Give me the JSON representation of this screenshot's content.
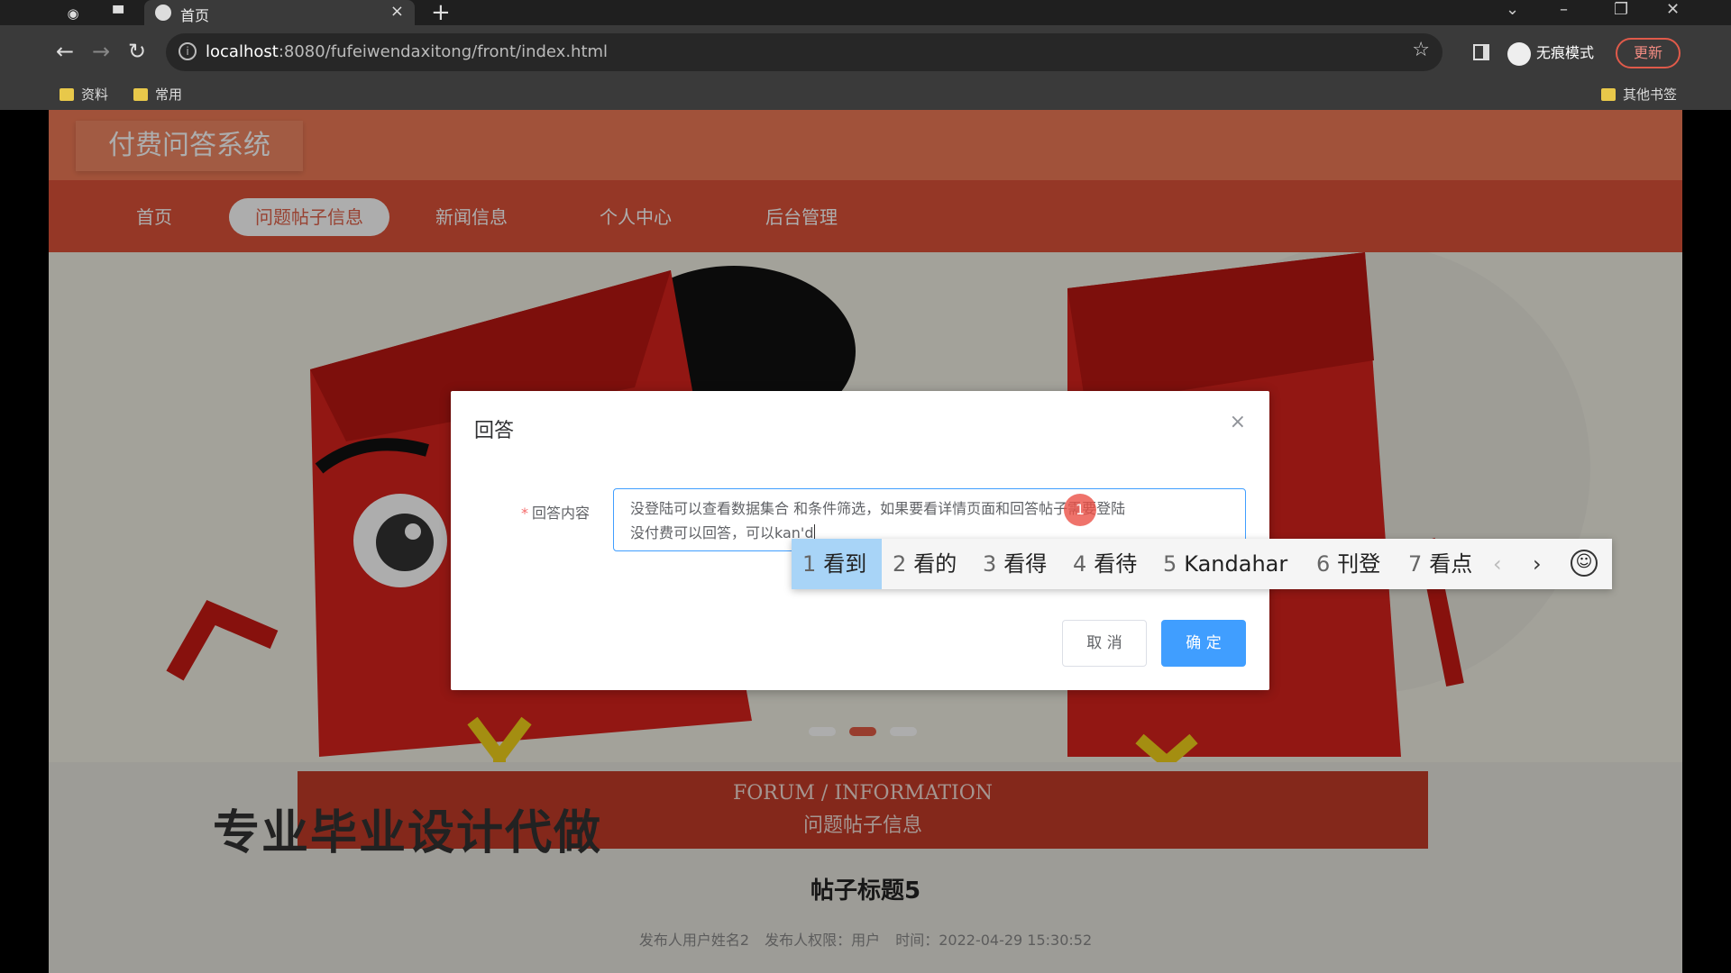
{
  "browser": {
    "tab_title": "首页",
    "url_host": "localhost",
    "url_rest": ":8080/fufeiwendaxitong/front/index.html",
    "incognito_label": "无痕模式",
    "update_label": "更新",
    "bookmarks": [
      "资料",
      "常用"
    ],
    "other_bookmarks": "其他书签"
  },
  "site": {
    "brand": "付费问答系统",
    "nav": [
      "首页",
      "问题帖子信息",
      "新闻信息",
      "个人中心",
      "后台管理"
    ],
    "active_nav": "问题帖子信息"
  },
  "section": {
    "title_en": "FORUM / INFORMATION",
    "title_cn": "问题帖子信息"
  },
  "watermark": "专业毕业设计代做",
  "post": {
    "title": "帖子标题5",
    "author": "发布人用户姓名2",
    "role": "发布人权限：用户",
    "time": "时间：2022-04-29 15:30:52"
  },
  "dialog": {
    "title": "回答",
    "close_icon": "close-icon",
    "field_label": "回答内容",
    "field_value": "没登陆可以查看数据集合 和条件筛选，如果要看详情页面和回答帖子需要登陆\n没付费可以回答，可以kan'd",
    "cursor_badge": "1",
    "cancel_label": "取 消",
    "confirm_label": "确 定"
  },
  "ime": {
    "candidates": [
      {
        "num": "1",
        "text": "看到"
      },
      {
        "num": "2",
        "text": "看的"
      },
      {
        "num": "3",
        "text": "看得"
      },
      {
        "num": "4",
        "text": "看待"
      },
      {
        "num": "5",
        "text": "Kandahar"
      },
      {
        "num": "6",
        "text": "刊登"
      },
      {
        "num": "7",
        "text": "看点"
      }
    ],
    "selected_index": 0
  },
  "colors": {
    "header": "#ee7a56",
    "navbar": "#dc5239",
    "primary": "#409eff"
  }
}
